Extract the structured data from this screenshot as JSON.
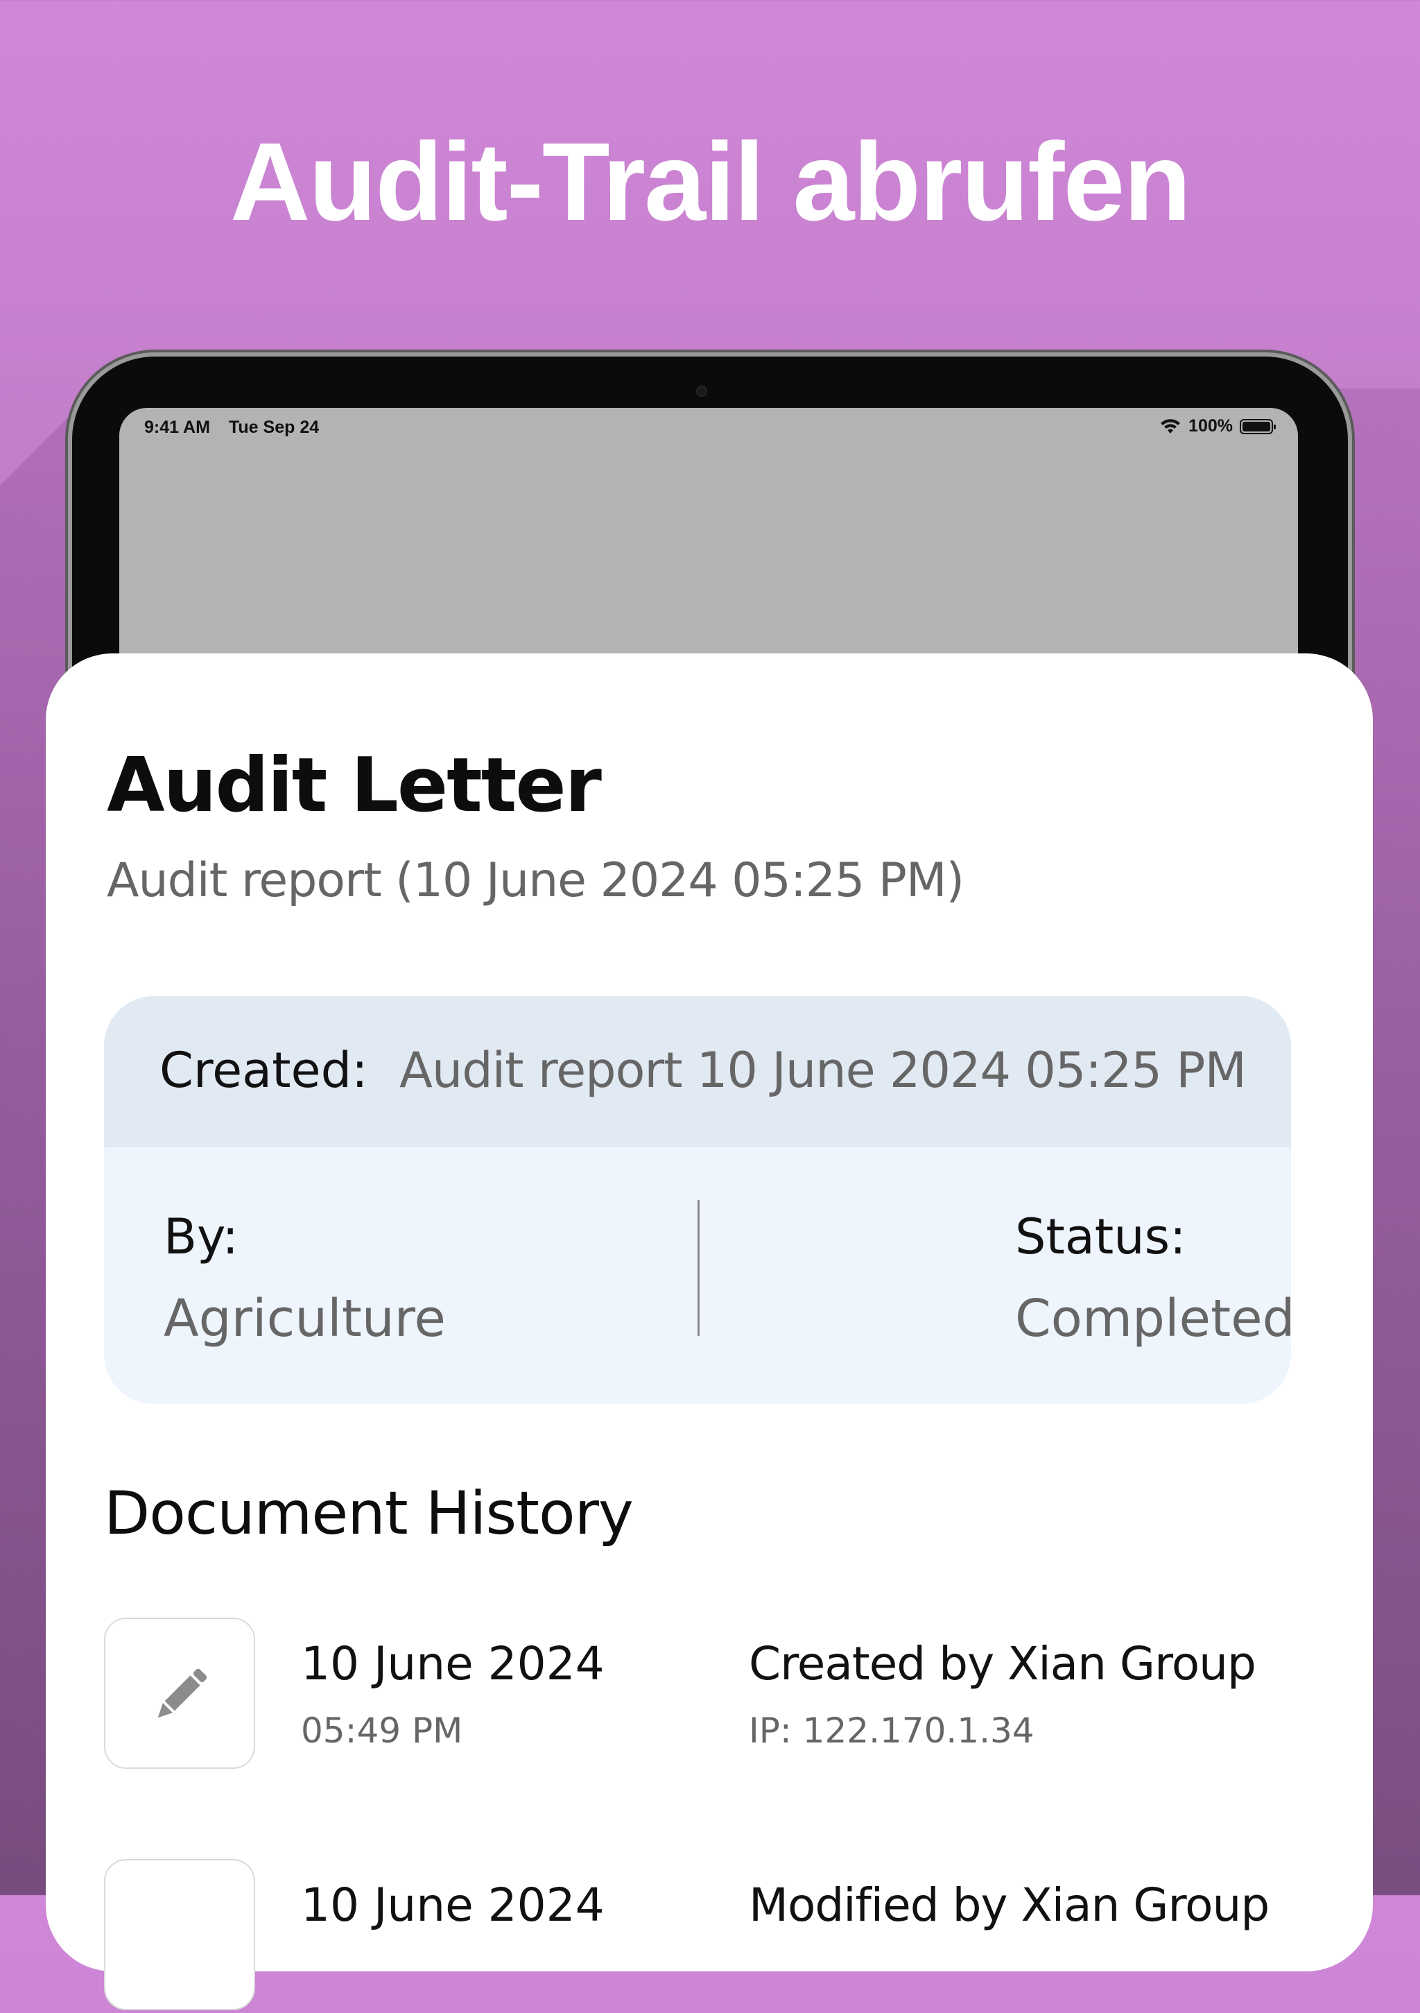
{
  "headline": "Audit-Trail abrufen",
  "status_bar": {
    "time": "9:41 AM",
    "date": "Tue Sep 24",
    "battery": "100%"
  },
  "document": {
    "title": "Audit Letter",
    "subtitle": "Audit report (10 June 2024 05:25 PM)"
  },
  "info": {
    "created_label": "Created:",
    "created_value": "Audit report 10 June 2024 05:25 PM",
    "by_label": "By:",
    "by_value": "Agriculture",
    "status_label": "Status:",
    "status_value": "Completed"
  },
  "history": {
    "title": "Document History",
    "items": [
      {
        "icon": "pencil-icon",
        "date": "10 June 2024",
        "time": "05:49 PM",
        "action": "Created by Xian Group",
        "ip": "IP: 122.170.1.34"
      },
      {
        "icon": "pencil-icon",
        "date": "10 June 2024",
        "time": "",
        "action": "Modified by Xian Group",
        "ip": ""
      }
    ]
  },
  "colors": {
    "background_top": "#d087d8",
    "background_bottom": "#7e5384",
    "card": "#ffffff",
    "info_header": "#e1e9f3",
    "info_body": "#eff5fd"
  }
}
